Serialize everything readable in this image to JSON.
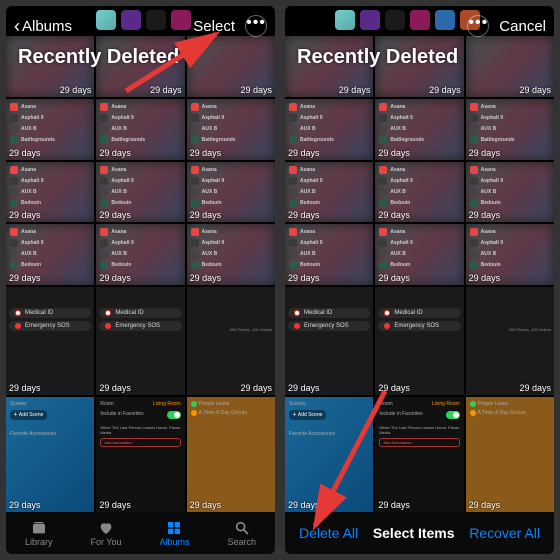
{
  "left": {
    "back": "Albums",
    "select": "Select",
    "title": "Recently Deleted",
    "tabs": {
      "library": "Library",
      "foryou": "For You",
      "albums": "Albums",
      "search": "Search"
    }
  },
  "right": {
    "cancel": "Cancel",
    "title": "Recently Deleted",
    "deleteAll": "Delete All",
    "selectItems": "Select Items",
    "recoverAll": "Recover All"
  },
  "days": "29 days",
  "apps": {
    "a": "Asana",
    "b": "Asphalt 9",
    "c": "AUX B",
    "d": "Battlegrounds",
    "e": "Bedouin"
  },
  "med": {
    "mid": "Medical ID",
    "sos": "Emergency SOS"
  },
  "hk": {
    "scenes": "Scenes",
    "addscene": "Add Scene",
    "fav": "Favorite Accessories",
    "room": "Room",
    "living": "Living Room",
    "inc": "Include in Favorites",
    "when": "When The Last Person Leaves Home, Pause Media",
    "add": "Add Automation",
    "people": "People Leave",
    "time": "A Time of Day Occurs",
    "meta": "505 Photos, 100 Videos"
  }
}
